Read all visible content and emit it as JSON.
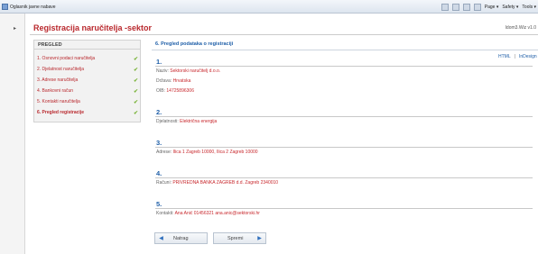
{
  "browser": {
    "tab_title": "Oglasnik javne nabave",
    "menus": [
      "Page ▾",
      "Safety ▾",
      "Tools ▾"
    ]
  },
  "header": {
    "title": "Registracija naručitelja -sektor",
    "version": "Idom3.Wiz v1.0"
  },
  "steps": {
    "heading": "PREGLED",
    "items": [
      {
        "label": "1. Osnovni podaci naručitelja",
        "done": true
      },
      {
        "label": "2. Djelatnost naručitelja",
        "done": true
      },
      {
        "label": "3. Adrese naručitelja",
        "done": true
      },
      {
        "label": "4. Bankovni račun",
        "done": true
      },
      {
        "label": "5. Kontakti naručitelja",
        "done": true
      },
      {
        "label": "6. Pregled registracije",
        "done": true
      }
    ],
    "check_glyph": "✔"
  },
  "content": {
    "heading": "6. Pregled podataka o registraciji",
    "links": {
      "html": "HTML",
      "sep": "|",
      "indesign": "InDesign"
    },
    "sections": [
      {
        "num": "1.",
        "fields": [
          {
            "label": "Naziv:",
            "value": "Sektorski naručitelj d.o.o."
          },
          {
            "label": "Država:",
            "value": "Hrvatska"
          },
          {
            "label": "OIB:",
            "value": "14725896306"
          }
        ]
      },
      {
        "num": "2.",
        "fields": [
          {
            "label": "Djelatnosti:",
            "value": "Električna energija"
          }
        ]
      },
      {
        "num": "3.",
        "fields": [
          {
            "label": "Adrese:",
            "value": "Ilica 1 Zagreb 10000, Ilica 2 Zagreb 10000"
          }
        ]
      },
      {
        "num": "4.",
        "fields": [
          {
            "label": "Računi:",
            "value": "PRIVREDNA BANKA ZAGREB d.d. Zagreb 2340010"
          }
        ]
      },
      {
        "num": "5.",
        "fields": [
          {
            "label": "Kontakti:",
            "value": "Ana Anić 01456321 ana.anic@sektorski.hr"
          }
        ]
      }
    ]
  },
  "buttons": {
    "back": "Natrag",
    "save": "Spremi"
  },
  "colors": {
    "accent_red": "#b9282d",
    "link_blue": "#1f5fa8",
    "check_green": "#7ab43a"
  }
}
